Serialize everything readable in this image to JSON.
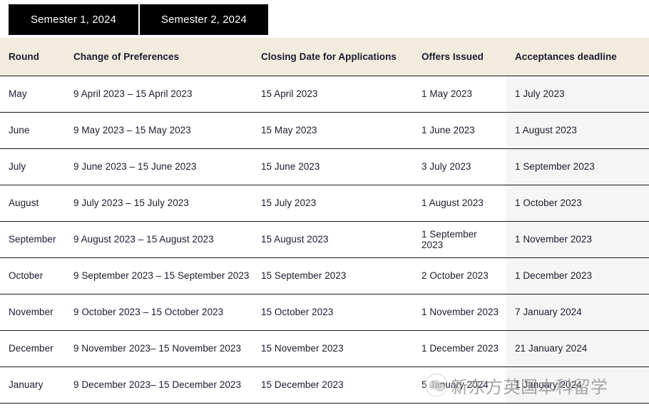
{
  "tabs": [
    {
      "label": "Semester 1, 2024",
      "active": true
    },
    {
      "label": "Semester 2, 2024",
      "active": false
    }
  ],
  "table": {
    "columns": [
      "Round",
      "Change of Preferences",
      "Closing Date for Applications",
      "Offers Issued",
      "Acceptances deadline"
    ],
    "rows": [
      {
        "round": "May",
        "change_of_preferences": "9 April 2023 – 15 April 2023",
        "closing_date": "15 April 2023",
        "offers_issued": "1 May 2023",
        "acceptances_deadline": "1 July 2023"
      },
      {
        "round": "June",
        "change_of_preferences": "9 May 2023 – 15 May 2023",
        "closing_date": "15 May 2023",
        "offers_issued": "1 June 2023",
        "acceptances_deadline": "1 August 2023"
      },
      {
        "round": "July",
        "change_of_preferences": "9 June 2023 – 15 June 2023",
        "closing_date": "15 June 2023",
        "offers_issued": "3 July 2023",
        "acceptances_deadline": "1 September 2023"
      },
      {
        "round": "August",
        "change_of_preferences": "9 July 2023 – 15 July 2023",
        "closing_date": "15 July 2023",
        "offers_issued": "1 August 2023",
        "acceptances_deadline": "1 October 2023"
      },
      {
        "round": "September",
        "change_of_preferences": "9 August 2023 – 15 August 2023",
        "closing_date": "15 August 2023",
        "offers_issued": "1 September 2023",
        "acceptances_deadline": "1 November 2023"
      },
      {
        "round": "October",
        "change_of_preferences": "9 September 2023 – 15 September 2023",
        "closing_date": "15 September 2023",
        "offers_issued": "2 October 2023",
        "acceptances_deadline": "1 December 2023"
      },
      {
        "round": "November",
        "change_of_preferences": "9 October 2023 – 15 October 2023",
        "closing_date": "15 October 2023",
        "offers_issued": "1 November 2023",
        "acceptances_deadline": "7 January 2024"
      },
      {
        "round": "December",
        "change_of_preferences": "9 November 2023– 15 November 2023",
        "closing_date": "15 November 2023",
        "offers_issued": "1 December 2023",
        "acceptances_deadline": "21 January 2024"
      },
      {
        "round": "January",
        "change_of_preferences": "9 December 2023– 15 December 2023",
        "closing_date": "15 December 2023",
        "offers_issued": "5 January 2024",
        "acceptances_deadline": "1 January 2024"
      }
    ]
  },
  "watermark": {
    "text": "新东方英国本科留学"
  },
  "colors": {
    "tab_background": "#000000",
    "tab_text": "#ffffff",
    "header_background": "#f3ebdd",
    "last_column_background": "#f5f5f5",
    "border": "#1a1a1a",
    "body_text": "#222233"
  }
}
